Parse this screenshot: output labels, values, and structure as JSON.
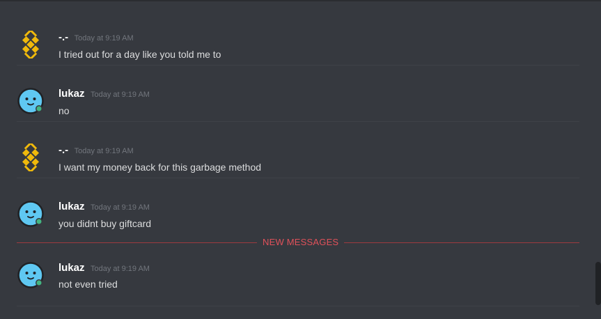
{
  "colors": {
    "background": "#36393f",
    "username": "#ffffff",
    "timestamp": "#72767d",
    "message_text": "#dcddde",
    "new_messages": "#e0515a",
    "binance_yellow": "#f0b90b",
    "lukaz_avatar": "#5fc8f2",
    "online_status": "#43b581"
  },
  "messages": [
    {
      "author": "-.-",
      "timestamp": "Today at 9:19 AM",
      "text": "I tried out for a day like you told me to",
      "avatar_icon": "binance-logo-icon"
    },
    {
      "author": "lukaz",
      "timestamp": "Today at 9:19 AM",
      "text": "no",
      "avatar_icon": "smiley-face-icon"
    },
    {
      "author": "-.-",
      "timestamp": "Today at 9:19 AM",
      "text": "I want my money back for this garbage method",
      "avatar_icon": "binance-logo-icon"
    },
    {
      "author": "lukaz",
      "timestamp": "Today at 9:19 AM",
      "text": "you didnt buy giftcard",
      "avatar_icon": "smiley-face-icon"
    },
    {
      "author": "lukaz",
      "timestamp": "Today at 9:19 AM",
      "text": "not even tried",
      "avatar_icon": "smiley-face-icon"
    }
  ],
  "new_messages_label": "NEW MESSAGES"
}
